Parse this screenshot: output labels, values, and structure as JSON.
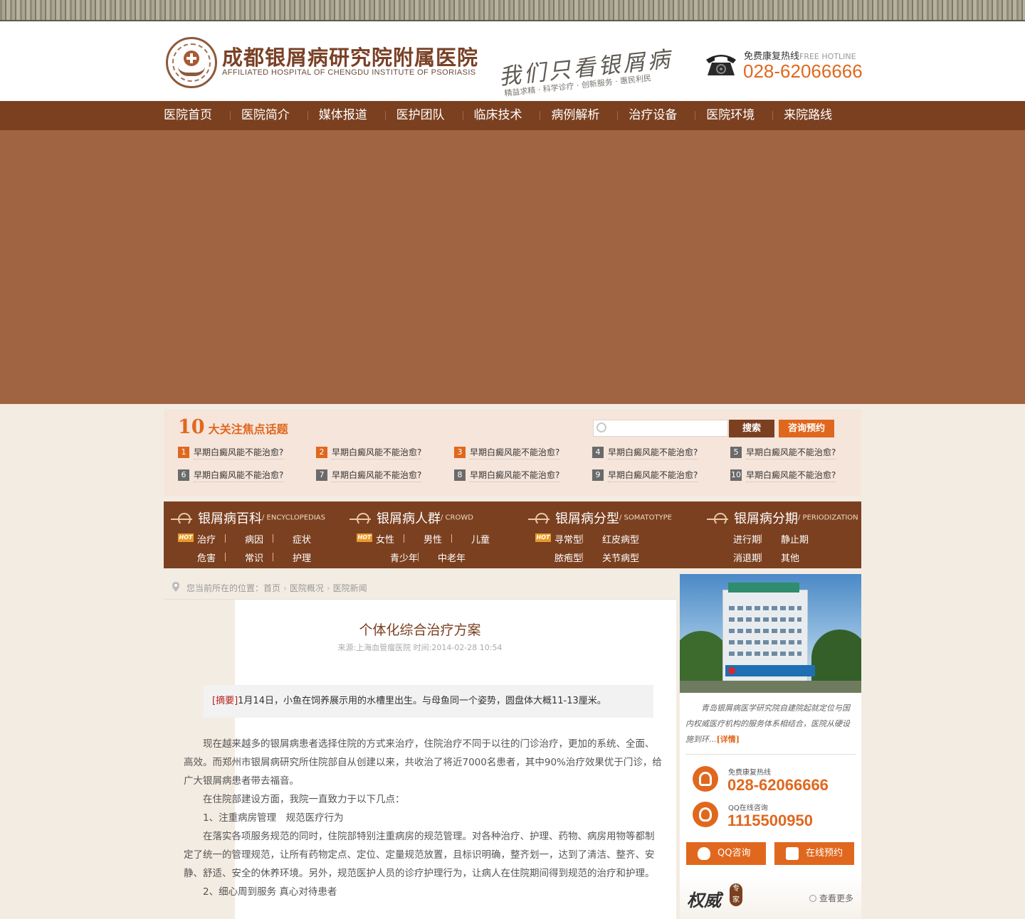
{
  "header": {
    "logo_cn": "成都银屑病研究院附属医院",
    "logo_en": "AFFILIATED HOSPITAL OF CHENGDU INSTITUTE OF PSORIASIS",
    "slogan": "我们只看银屑病",
    "slogan_sub": "精益求精 · 科学诊疗 · 创新服务 · 惠民利民",
    "hotline_label": "免费康复热线",
    "hotline_label_en": "FREE HOTLINE",
    "hotline_number": "028-62066666"
  },
  "nav": {
    "items": [
      "医院首页",
      "医院简介",
      "媒体报道",
      "医护团队",
      "临床技术",
      "病例解析",
      "治疗设备",
      "医院环境",
      "来院路线"
    ]
  },
  "topics": {
    "title_num": "10",
    "title_text": "大关注焦点话题",
    "search_placeholder": "",
    "search_button": "搜索",
    "consult_button": "咨询预约",
    "items": [
      {
        "num": "1",
        "text": "早期白癜风能不能治愈?"
      },
      {
        "num": "2",
        "text": "早期白癜风能不能治愈?"
      },
      {
        "num": "3",
        "text": "早期白癜风能不能治愈?"
      },
      {
        "num": "4",
        "text": "早期白癜风能不能治愈?"
      },
      {
        "num": "5",
        "text": "早期白癜风能不能治愈?"
      },
      {
        "num": "6",
        "text": "早期白癜风能不能治愈?"
      },
      {
        "num": "7",
        "text": "早期白癜风能不能治愈?"
      },
      {
        "num": "8",
        "text": "早期白癜风能不能治愈?"
      },
      {
        "num": "9",
        "text": "早期白癜风能不能治愈?"
      },
      {
        "num": "10",
        "text": "早期白癜风能不能治愈?"
      }
    ]
  },
  "categories": [
    {
      "title": "银屑病百科",
      "en": "/ ENCYCLOPEDIAS",
      "hot": "HOT",
      "row1": [
        "治疗",
        "病因",
        "症状"
      ],
      "row2": [
        "危害",
        "常识",
        "护理"
      ]
    },
    {
      "title": "银屑病人群",
      "en": "/ CROWD",
      "hot": "HOT",
      "row1": [
        "女性",
        "男性",
        "儿童"
      ],
      "row2": [
        "青少年",
        "中老年"
      ]
    },
    {
      "title": "银屑病分型",
      "en": "/ SOMATOTYPE",
      "hot": "HOT",
      "row1": [
        "寻常型",
        "红皮病型"
      ],
      "row2": [
        "脓疱型",
        "关节病型"
      ]
    },
    {
      "title": "银屑病分期",
      "en": "/ PERIODIZATION",
      "row1": [
        "进行期",
        "静止期"
      ],
      "row2": [
        "消退期",
        "其他"
      ]
    }
  ],
  "breadcrumb": {
    "prefix": "您当前所在的位置：",
    "items": [
      "首页",
      "医院概况",
      "医院新闻"
    ]
  },
  "article": {
    "title": "个体化综合治疗方案",
    "meta": "来源:上海血管瘤医院 时间:2014-02-28 10:54",
    "summary_tag": "[摘要]",
    "summary": "1月14日，小鱼在饲养展示用的水槽里出生。与母鱼同一个姿势，圆盘体大概11-13厘米。",
    "paragraphs": [
      " 现在越来越多的银屑病患者选择住院的方式来治疗，住院治疗不同于以往的门诊治疗，更加的系统、全面、高效。而郑州市银屑病研究所住院部自从创建以来，共收治了将近7000名患者，其中90%治疗效果优于门诊，给广大银屑病患者带去福音。",
      "在住院部建设方面，我院一直致力于以下几点：",
      "1、注重病房管理　规范医疗行为",
      "在落实各项服务规范的同时，住院部特别注重病房的规范管理。对各种治疗、护理、药物、病房用物等都制定了统一的管理规范，让所有药物定点、定位、定量规范放置，且标识明确，整齐划一，达到了清洁、整齐、安静、舒适、安全的休养环境。另外，规范医护人员的诊疗护理行为，让病人在住院期间得到规范的治疗和护理。",
      "2、细心周到服务 真心对待患者"
    ]
  },
  "sidebar": {
    "desc": "青岛银屑病医学研究院自建院起就定位与国内权威医疗机构的服务体系相结合，医院从硬设施到环...",
    "desc_more": "[详情]",
    "hotline_label": "免费康复热线",
    "hotline_number": "028-62066666",
    "qq_label": "QQ在线咨询",
    "qq_number": "1115500950",
    "btn_qq": "QQ咨询",
    "btn_online": "在线预约",
    "expert_title": "权威",
    "expert_seal": "专家",
    "view_more": "查看更多"
  },
  "colors": {
    "brown": "#7b4020",
    "orange": "#e0681e",
    "banner": "#a06442",
    "topics_bg": "#f6e5db"
  }
}
